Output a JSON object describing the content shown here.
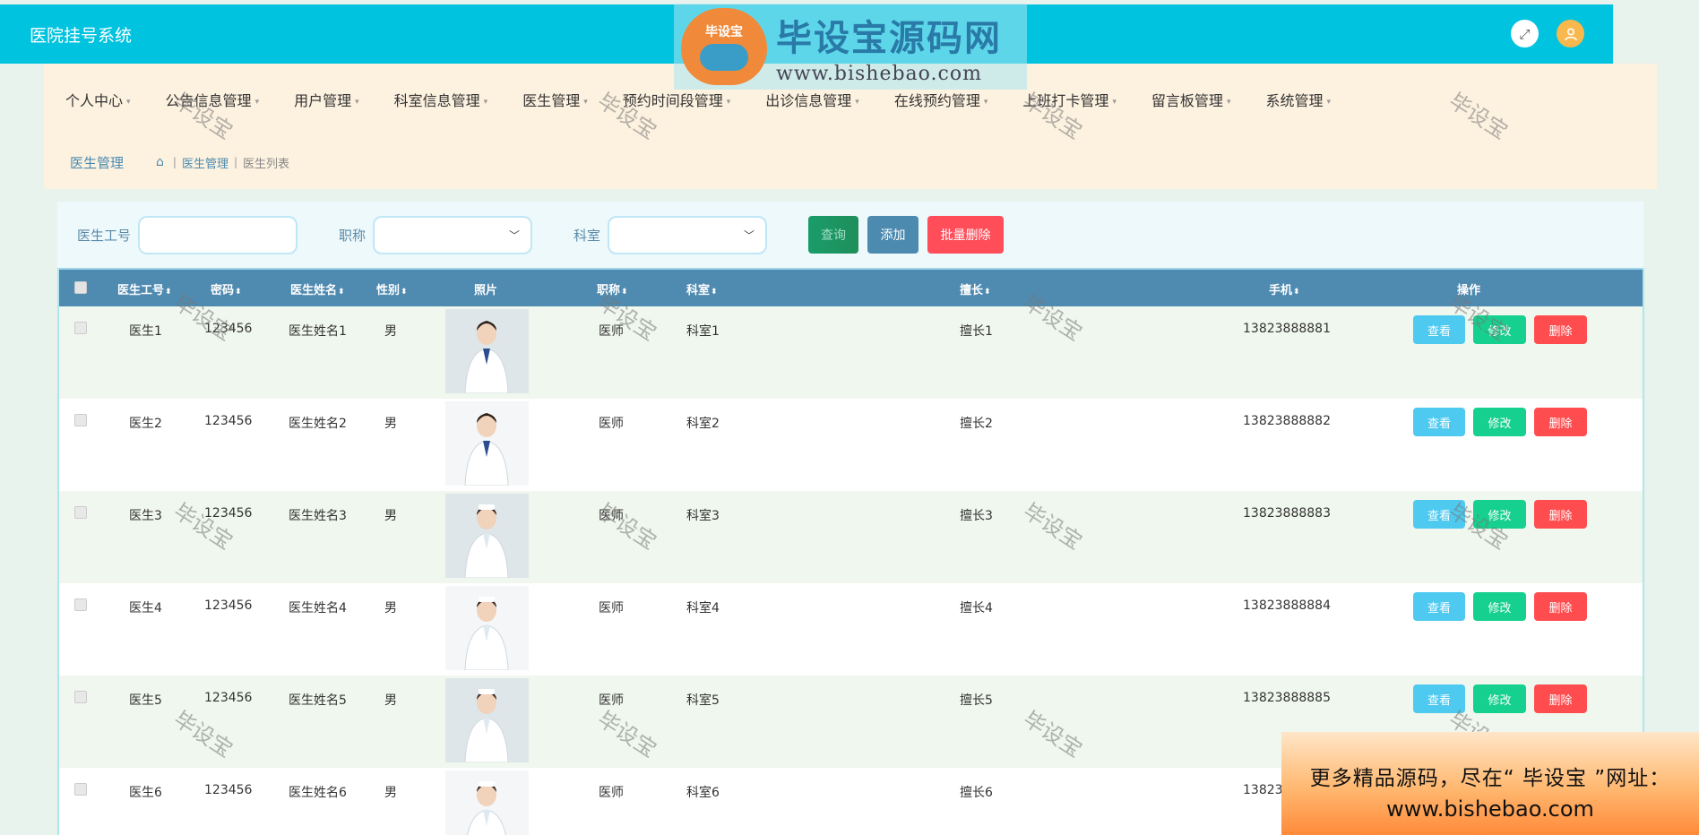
{
  "app": {
    "title": "医院挂号系统"
  },
  "header_icons": {
    "expand": "expand-icon",
    "user": "user-icon"
  },
  "logo_watermark": {
    "name": "毕设宝源码网",
    "url": "www.bishebao.com",
    "badge": "毕设宝"
  },
  "nav": [
    {
      "label": "个人中心",
      "dropdown": true
    },
    {
      "label": "公告信息管理",
      "dropdown": true
    },
    {
      "label": "用户管理",
      "dropdown": true
    },
    {
      "label": "科室信息管理",
      "dropdown": true
    },
    {
      "label": "医生管理",
      "dropdown": true
    },
    {
      "label": "预约时间段管理",
      "dropdown": true
    },
    {
      "label": "出诊信息管理",
      "dropdown": true
    },
    {
      "label": "在线预约管理",
      "dropdown": true
    },
    {
      "label": "上班打卡管理",
      "dropdown": true
    },
    {
      "label": "留言板管理",
      "dropdown": true
    },
    {
      "label": "系统管理",
      "dropdown": true
    }
  ],
  "breadcrumb": {
    "title": "医生管理",
    "path": [
      "医生管理",
      "医生列表"
    ]
  },
  "search": {
    "fields": [
      {
        "label": "医生工号",
        "type": "input",
        "value": ""
      },
      {
        "label": "职称",
        "type": "select",
        "value": ""
      },
      {
        "label": "科室",
        "type": "select",
        "value": ""
      }
    ],
    "buttons": {
      "search": "查询",
      "add": "添加",
      "batch_delete": "批量删除"
    }
  },
  "table": {
    "headers": [
      "医生工号",
      "密码",
      "医生姓名",
      "性别",
      "照片",
      "职称",
      "科室",
      "擅长",
      "手机",
      "操作"
    ],
    "actions": {
      "view": "查看",
      "edit": "修改",
      "delete": "删除"
    },
    "rows": [
      {
        "id": "医生1",
        "password": "123456",
        "name": "医生姓名1",
        "gender": "男",
        "title": "医师",
        "dept": "科室1",
        "skill": "擅长1",
        "phone": "13823888881"
      },
      {
        "id": "医生2",
        "password": "123456",
        "name": "医生姓名2",
        "gender": "男",
        "title": "医师",
        "dept": "科室2",
        "skill": "擅长2",
        "phone": "13823888882"
      },
      {
        "id": "医生3",
        "password": "123456",
        "name": "医生姓名3",
        "gender": "男",
        "title": "医师",
        "dept": "科室3",
        "skill": "擅长3",
        "phone": "13823888883"
      },
      {
        "id": "医生4",
        "password": "123456",
        "name": "医生姓名4",
        "gender": "男",
        "title": "医师",
        "dept": "科室4",
        "skill": "擅长4",
        "phone": "13823888884"
      },
      {
        "id": "医生5",
        "password": "123456",
        "name": "医生姓名5",
        "gender": "男",
        "title": "医师",
        "dept": "科室5",
        "skill": "擅长5",
        "phone": "13823888885"
      },
      {
        "id": "医生6",
        "password": "123456",
        "name": "医生姓名6",
        "gender": "男",
        "title": "医师",
        "dept": "科室6",
        "skill": "擅长6",
        "phone": "13823888886"
      }
    ]
  },
  "watermark_text": "毕设宝",
  "promo": {
    "line1": "更多精品源码，尽在“ 毕设宝 ”网址：",
    "line2": "www.bishebao.com"
  }
}
